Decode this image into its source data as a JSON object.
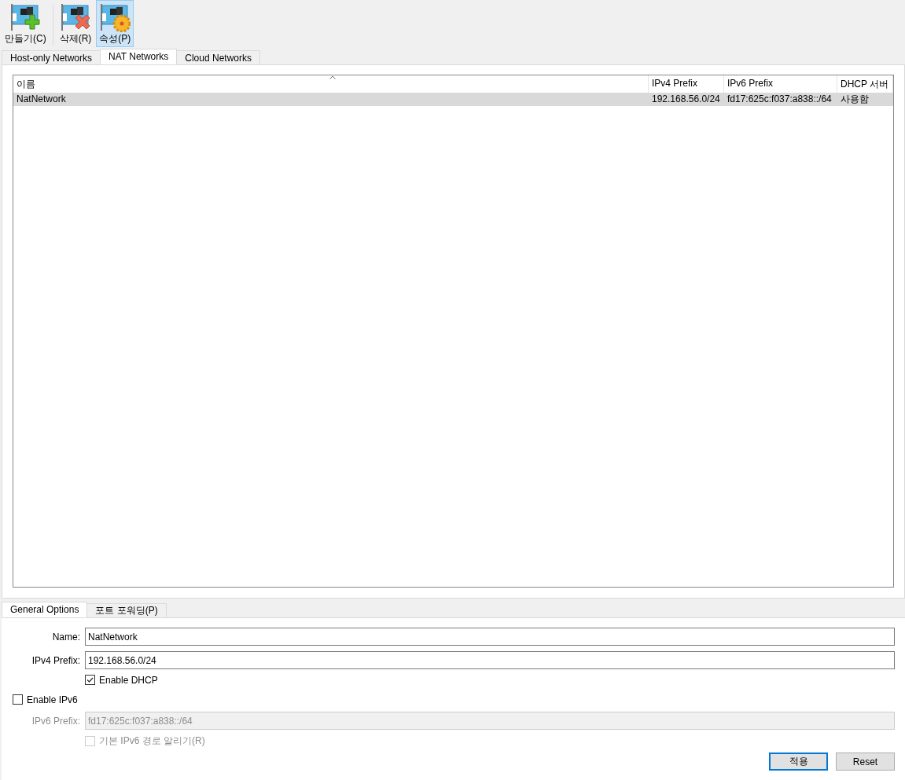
{
  "toolbar": [
    {
      "label": "만들기(C)",
      "kind": "create",
      "selected": false
    },
    {
      "label": "삭제(R)",
      "kind": "remove",
      "selected": false
    },
    {
      "label": "속성(P)",
      "kind": "properties",
      "selected": true
    }
  ],
  "tabs": [
    {
      "label": "Host-only Networks",
      "selected": false
    },
    {
      "label": "NAT Networks",
      "selected": true
    },
    {
      "label": "Cloud Networks",
      "selected": false
    }
  ],
  "table": {
    "columns": [
      "이름",
      "IPv4 Prefix",
      "IPv6 Prefix",
      "DHCP 서버"
    ],
    "rows": [
      {
        "cells": [
          "NatNetwork",
          "192.168.56.0/24",
          "fd17:625c:f037:a838::/64",
          "사용함"
        ],
        "selected": true
      }
    ]
  },
  "detail_tabs": [
    {
      "label": "General Options",
      "selected": true
    },
    {
      "label": "포트 포워딩(P)",
      "selected": false
    }
  ],
  "form": {
    "name_label": "Name:",
    "name_value": "NatNetwork",
    "ipv4_label": "IPv4 Prefix:",
    "ipv4_value": "192.168.56.0/24",
    "dhcp": {
      "label": "Enable DHCP",
      "checked": true,
      "disabled": false
    },
    "ipv6": {
      "label": "Enable IPv6",
      "checked": false,
      "disabled": false
    },
    "ipv6_prefix_label": "IPv6 Prefix:",
    "ipv6_prefix_value": "fd17:625c:f037:a838::/64",
    "ipv6_prefix_disabled": true,
    "default_route": {
      "label": "기본 IPv6 경로 알리기(R)",
      "checked": false,
      "disabled": true
    }
  },
  "buttons": [
    {
      "label": "적용",
      "default": true
    },
    {
      "label": "Reset",
      "default": false
    }
  ]
}
